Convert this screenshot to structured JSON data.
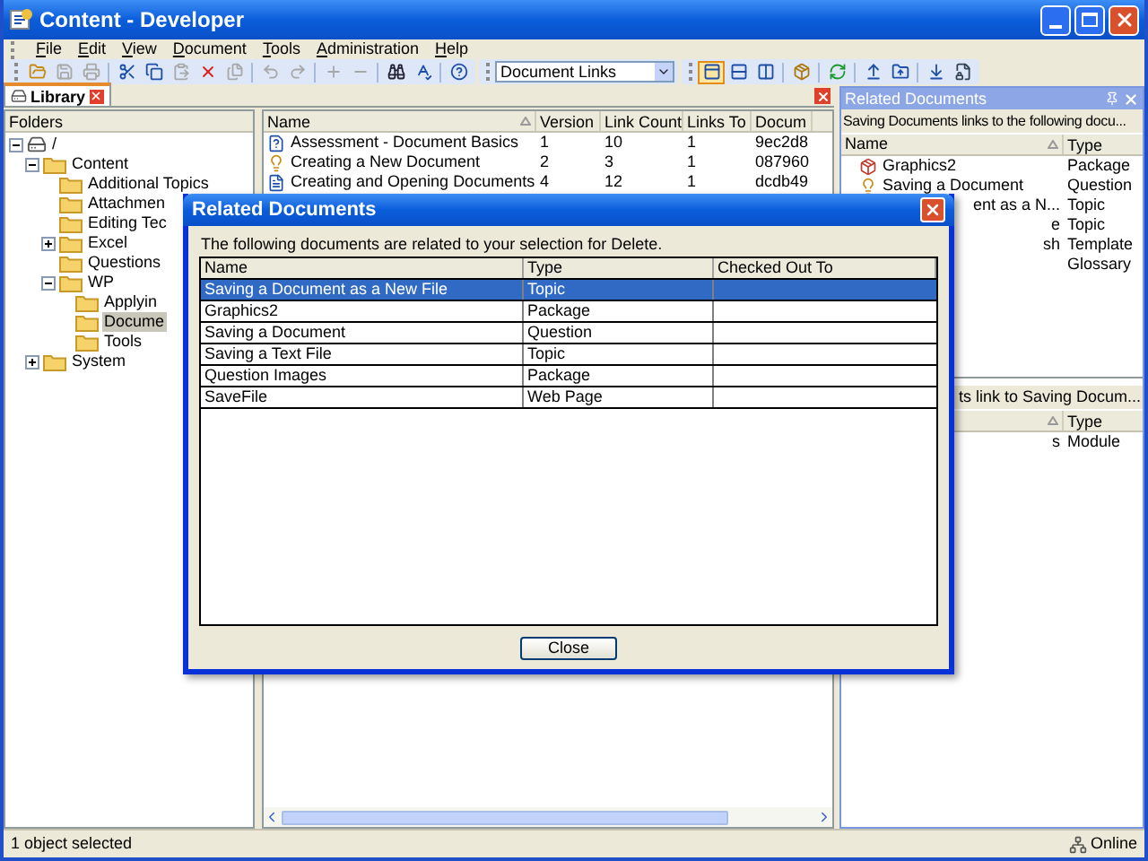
{
  "window": {
    "title": "Content - Developer"
  },
  "menu": [
    "File",
    "Edit",
    "View",
    "Document",
    "Tools",
    "Administration",
    "Help"
  ],
  "toolbar": {
    "left": [
      [
        {
          "kind": "open",
          "disabled": false
        },
        {
          "kind": "save",
          "disabled": true
        },
        {
          "kind": "print",
          "disabled": true
        }
      ],
      [
        {
          "kind": "cut",
          "disabled": false
        },
        {
          "kind": "copy",
          "disabled": false
        },
        {
          "kind": "paste",
          "disabled": true
        },
        {
          "kind": "delete",
          "disabled": false
        },
        {
          "kind": "properties",
          "disabled": true
        }
      ],
      [
        {
          "kind": "undo",
          "disabled": true
        },
        {
          "kind": "redo",
          "disabled": true
        }
      ],
      [
        {
          "kind": "add",
          "disabled": true
        },
        {
          "kind": "remove",
          "disabled": true
        }
      ],
      [
        {
          "kind": "find",
          "disabled": false
        },
        {
          "kind": "spell",
          "disabled": false
        }
      ],
      [
        {
          "kind": "help",
          "disabled": false
        }
      ]
    ],
    "filter": {
      "value": "Document Links"
    },
    "right": [
      [
        {
          "kind": "view-top",
          "selected": true
        },
        {
          "kind": "view-rows",
          "selected": false
        },
        {
          "kind": "view-columns",
          "selected": false
        }
      ],
      [
        {
          "kind": "publish",
          "selected": false
        }
      ],
      [
        {
          "kind": "refresh",
          "selected": false
        }
      ],
      [
        {
          "kind": "upload",
          "selected": false
        },
        {
          "kind": "folder-up",
          "selected": false
        }
      ],
      [
        {
          "kind": "download",
          "selected": false
        },
        {
          "kind": "lock",
          "selected": false
        }
      ]
    ]
  },
  "library": {
    "tab": "Library",
    "folders_header": "Folders",
    "tree": [
      {
        "label": "/",
        "kind": "drive",
        "expanded": true,
        "selected": false,
        "children": [
          {
            "label": "Content",
            "kind": "folder",
            "expanded": true,
            "selected": false,
            "children": [
              {
                "label": "Additional Topics",
                "kind": "folder",
                "selected": false
              },
              {
                "label": "Attachmen",
                "kind": "folder",
                "selected": false
              },
              {
                "label": "Editing Tec",
                "kind": "folder",
                "selected": false
              },
              {
                "label": "Excel",
                "kind": "folder",
                "expanded": false,
                "selected": false
              },
              {
                "label": "Questions",
                "kind": "folder",
                "selected": false
              },
              {
                "label": "WP",
                "kind": "folder",
                "expanded": true,
                "selected": false,
                "children": [
                  {
                    "label": "Applyin",
                    "kind": "folder",
                    "selected": false
                  },
                  {
                    "label": "Docume",
                    "kind": "folder",
                    "selected": true
                  },
                  {
                    "label": "Tools",
                    "kind": "folder",
                    "selected": false
                  }
                ]
              }
            ]
          },
          {
            "label": "System",
            "kind": "folder",
            "expanded": false,
            "selected": false
          }
        ]
      }
    ],
    "columns": [
      "Name",
      "Version",
      "Link Count",
      "Links To",
      "Docum"
    ],
    "rows": [
      {
        "kind": "assessment",
        "cells": [
          "Assessment - Document Basics",
          "1",
          "10",
          "1",
          "9ec2d8"
        ]
      },
      {
        "kind": "question",
        "cells": [
          "Creating a New Document",
          "2",
          "3",
          "1",
          "087960"
        ]
      },
      {
        "kind": "topic",
        "cells": [
          "Creating and Opening Documents",
          "4",
          "12",
          "1",
          "dcdb49"
        ]
      }
    ]
  },
  "related_panel": {
    "title": "Related Documents",
    "caption": "Saving Documents links to the following docu...",
    "columns": [
      "Name",
      "Type"
    ],
    "rows": [
      {
        "kind": "package",
        "name": "Graphics2",
        "type": "Package"
      },
      {
        "kind": "question",
        "name": "Saving a Document",
        "type": "Question"
      },
      {
        "name": "ent as a N...",
        "type": "Topic"
      },
      {
        "name": "e",
        "type": "Topic"
      },
      {
        "name": "sh",
        "type": "Template"
      },
      {
        "type": "Glossary"
      }
    ],
    "lower_caption": "ts link to Saving Docum...",
    "lower_columns": [
      "Type"
    ],
    "lower_rows": [
      {
        "name": "s",
        "type": "Module"
      }
    ]
  },
  "dialog": {
    "title": "Related Documents",
    "message": "The following documents are related to your selection for Delete.",
    "columns": [
      "Name",
      "Type",
      "Checked Out To"
    ],
    "rows": [
      {
        "name": "Saving a Document as a New File",
        "type": "Topic",
        "selected": true
      },
      {
        "name": "Graphics2",
        "type": "Package",
        "selected": false
      },
      {
        "name": "Saving a Document",
        "type": "Question",
        "selected": false
      },
      {
        "name": "Saving a Text File",
        "type": "Topic",
        "selected": false
      },
      {
        "name": "Question Images",
        "type": "Package",
        "selected": false
      },
      {
        "name": "SaveFile",
        "type": "Web Page",
        "selected": false
      }
    ],
    "button": "Close"
  },
  "status_bar": {
    "message": "1 object selected",
    "connection": "Online"
  }
}
